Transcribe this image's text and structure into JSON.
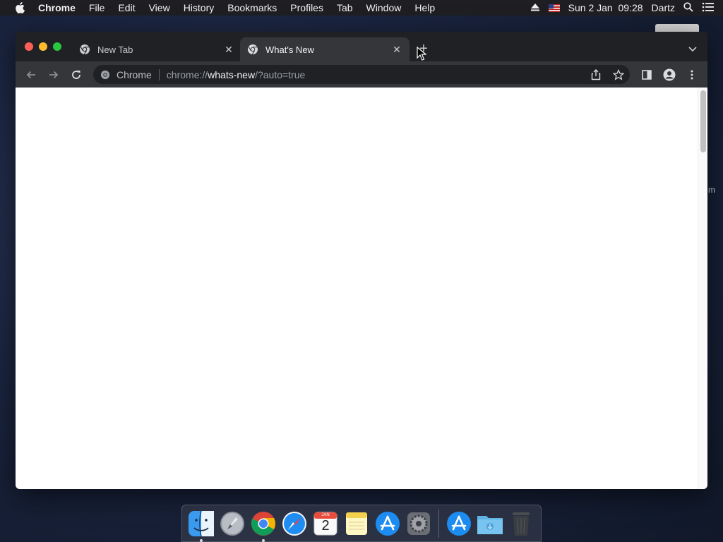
{
  "menubar": {
    "app_name": "Chrome",
    "menus": [
      "File",
      "Edit",
      "View",
      "History",
      "Bookmarks",
      "Profiles",
      "Tab",
      "Window",
      "Help"
    ],
    "clock": "Sun 2 Jan  09:28",
    "user": "Dartz"
  },
  "browser": {
    "tabs": [
      {
        "title": "New Tab",
        "active": false
      },
      {
        "title": "What's New",
        "active": true
      }
    ],
    "omnibox": {
      "chip": "Chrome",
      "url_scheme": "chrome://",
      "url_host": "whats-new",
      "url_rest": "/?auto=true"
    }
  },
  "desktop": {
    "partial_label": "m"
  },
  "dock": {
    "apps": [
      "finder",
      "launchpad",
      "chrome",
      "safari",
      "calendar",
      "notes",
      "app-store",
      "system-preferences",
      "app-store-2",
      "downloads",
      "trash"
    ],
    "calendar": {
      "month": "JAN",
      "day": "2"
    }
  },
  "colors": {
    "traffic_close": "#ff5f57",
    "traffic_min": "#febc2e",
    "traffic_max": "#28c840"
  }
}
